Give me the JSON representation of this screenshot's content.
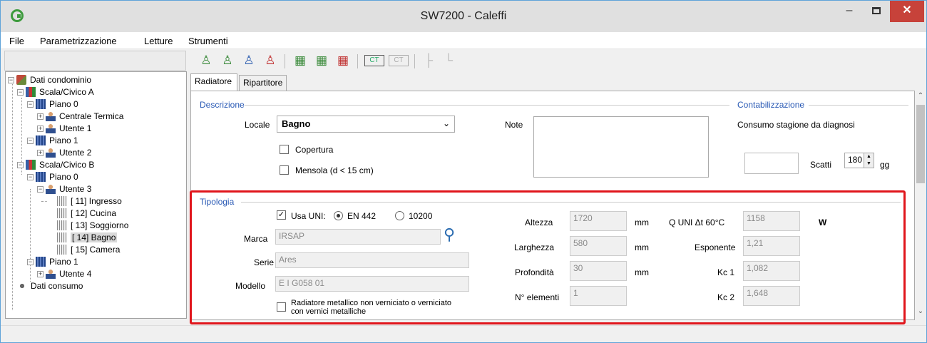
{
  "window": {
    "title": "SW7200 - Caleffi",
    "minimize": "–",
    "close": "✕"
  },
  "menu": [
    "File",
    "Parametrizzazione",
    "Letture",
    "Strumenti"
  ],
  "toolbar": {
    "icons": [
      "add-user-icon",
      "add-users-icon",
      "move-user-icon",
      "delete-user-icon",
      "add-radiator-icon",
      "add-radiator-multi-icon",
      "delete-radiator-icon",
      "add-ct-icon",
      "ct-icon",
      "pipe-icon",
      "pipe-alt-icon"
    ]
  },
  "tree": {
    "root": "Dati condominio",
    "scala_a": "Scala/Civico A",
    "piano_0a": "Piano  0",
    "centrale": "Centrale Termica",
    "utente1": "Utente 1",
    "piano_1a": "Piano  1",
    "utente2": "Utente 2",
    "scala_b": "Scala/Civico B",
    "piano_0b": "Piano  0",
    "utente3": "Utente 3",
    "r11": "[ 11] Ingresso",
    "r12": "[ 12] Cucina",
    "r13": "[ 13] Soggiorno",
    "r14": "[ 14] Bagno",
    "r15": "[ 15] Camera",
    "piano_1b": "Piano  1",
    "utente4": "Utente 4",
    "consumo": "Dati consumo"
  },
  "tabs": [
    "Radiatore",
    "Ripartitore"
  ],
  "descrizione": {
    "title": "Descrizione",
    "locale_label": "Locale",
    "locale_value": "Bagno",
    "copertura": "Copertura",
    "mensola": "Mensola (d < 15 cm)",
    "note_label": "Note"
  },
  "contabilizzazione": {
    "title": "Contabilizzazione",
    "consumo_label": "Consumo stagione da diagnosi",
    "scatti_label": "Scatti",
    "gg_value": "180",
    "gg_label": "gg"
  },
  "tipologia": {
    "title": "Tipologia",
    "usa_uni": "Usa UNI:",
    "en442": "EN 442",
    "r10200": "10200",
    "marca_label": "Marca",
    "marca_value": "IRSAP",
    "serie_label": "Serie",
    "serie_value": "Ares",
    "modello_label": "Modello",
    "modello_value": "E I G058  01",
    "metallico_line1": "Radiatore metallico non verniciato o verniciato",
    "metallico_line2": "con vernici metalliche",
    "altezza_label": "Altezza",
    "altezza_value": "1720",
    "larghezza_label": "Larghezza",
    "larghezza_value": "580",
    "profondita_label": "Profondità",
    "profondita_value": "30",
    "elementi_label": "N° elementi",
    "elementi_value": "1",
    "mm": "mm",
    "quni_label": "Q UNI Δt 60°C",
    "quni_value": "1158",
    "w_unit": "W",
    "esponente_label": "Esponente",
    "esponente_value": "1,21",
    "kc1_label": "Kc 1",
    "kc1_value": "1,082",
    "kc2_label": "Kc 2",
    "kc2_value": "1,648"
  },
  "colors": {
    "accent_title": "#2a5ab5",
    "highlight": "#e0151b",
    "close_button": "#c7423a"
  }
}
